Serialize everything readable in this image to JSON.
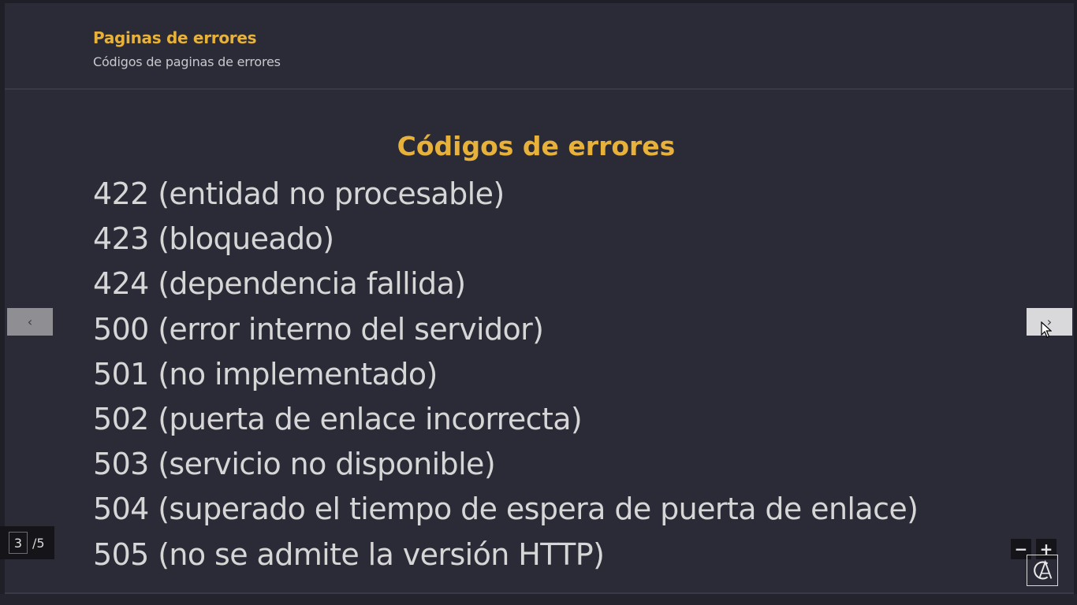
{
  "header": {
    "title": "Paginas de errores",
    "subtitle": "Códigos de paginas de errores"
  },
  "slide": {
    "title": "Códigos de errores",
    "items": [
      "422 (entidad no procesable)",
      "423 (bloqueado)",
      "424 (dependencia fallida)",
      "500 (error interno del servidor)",
      "501 (no implementado)",
      "502 (puerta de enlace incorrecta)",
      "503 (servicio no disponible)",
      "504 (superado el tiempo de espera de puerta de enlace)",
      "505 (no se admite la versión HTTP)"
    ]
  },
  "navigation": {
    "prev_label": "‹",
    "next_label": "›"
  },
  "pagination": {
    "current": "3",
    "total": "/5"
  },
  "zoom": {
    "out_label": "−",
    "in_label": "+"
  },
  "colors": {
    "background": "#2a2b37",
    "accent": "#e8b23a",
    "text": "#d6d6d6"
  },
  "icons": {
    "logo": "ca-logo-icon",
    "cursor": "mouse-pointer-icon"
  }
}
